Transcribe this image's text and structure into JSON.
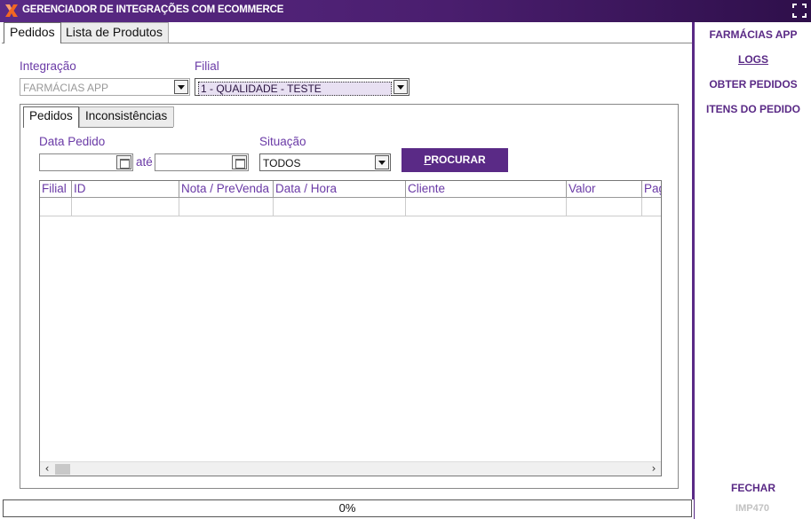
{
  "window": {
    "title": "GERENCIADOR DE INTEGRAÇÕES COM ECOMMERCE"
  },
  "colors": {
    "accent": "#5a2a86",
    "label": "#6a3aa6",
    "muted": "#c2c2c2"
  },
  "icons": {
    "logo": "x-logo-icon",
    "maximize": "expand-corners-icon",
    "calendar": "calendar-icon",
    "dropdown": "chevron-down-icon"
  },
  "top_tabs": [
    {
      "label": "Pedidos",
      "active": true
    },
    {
      "label": "Lista de Produtos",
      "active": false
    }
  ],
  "filters": {
    "integracao_label": "Integração",
    "integracao_value": "FARMÁCIAS APP",
    "filial_label": "Filial",
    "filial_value": "1 - QUALIDADE - TESTE"
  },
  "inner_tabs": [
    {
      "label": "Pedidos",
      "active": true
    },
    {
      "label": "Inconsistências",
      "active": false
    }
  ],
  "search": {
    "data_label": "Data Pedido",
    "ate_label": "até",
    "data_inicio": "",
    "data_fim": "",
    "situacao_label": "Situação",
    "situacao_value": "TODOS",
    "procurar_prefix": "P",
    "procurar_rest": "ROCURAR"
  },
  "grid": {
    "columns": [
      "Filial",
      "ID",
      "Nota / PreVenda",
      "Data / Hora",
      "Cliente",
      "Valor",
      "Pag"
    ],
    "rows": []
  },
  "sidebar": {
    "items": [
      {
        "label": "FARMÁCIAS APP",
        "accel_index": 10
      },
      {
        "label": "LOGS",
        "accel_index": 0
      },
      {
        "label": "OBTER PEDIDOS",
        "accel_index": 0
      },
      {
        "label": "ITENS DO PEDIDO",
        "accel_index": 0
      }
    ],
    "fechar": "FECHAR"
  },
  "status": {
    "progress_text": "0%",
    "progress_value": 0,
    "version": "IMP470"
  }
}
